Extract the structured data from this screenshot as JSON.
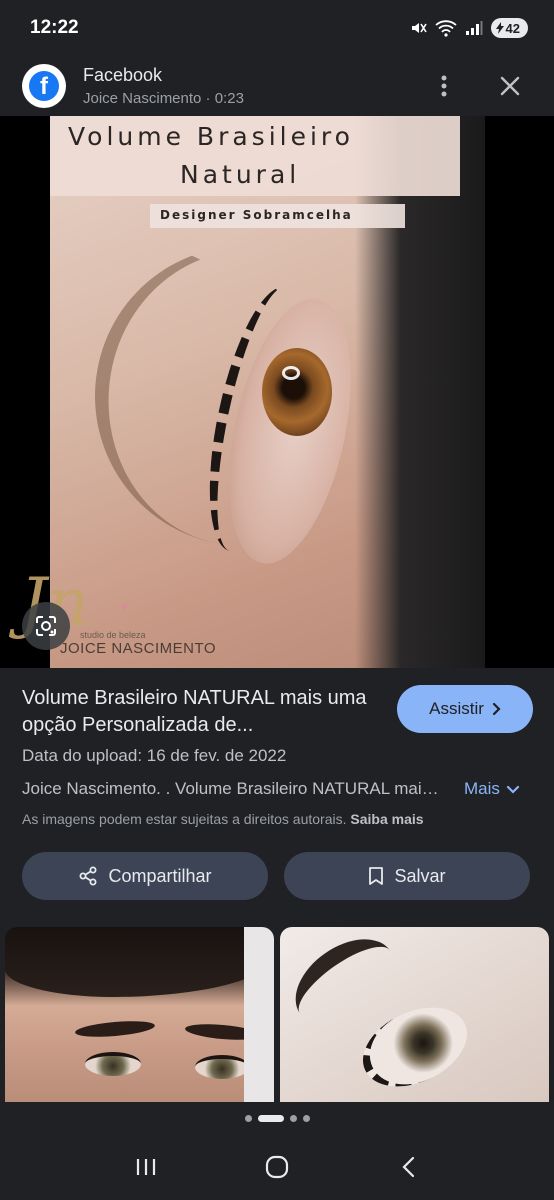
{
  "status_bar": {
    "time": "12:22",
    "battery": "42",
    "network": "5"
  },
  "source": {
    "name": "Facebook",
    "subtitle": "Joice Nascimento · 0:23",
    "logo_letter": "f",
    "brand_color": "#1877f2"
  },
  "image": {
    "title_line1": "Volume Brasileiro",
    "title_line2": "Natural",
    "subtitle": "Designer Sobramcelha",
    "watermark_script": "Jn",
    "watermark_studio": "studio de beleza",
    "watermark_name": "JOICE NASCIMENTO"
  },
  "result": {
    "title": "Volume Brasileiro NATURAL mais uma opção Personalizada de...",
    "upload_date": "Data do upload: 16 de fev. de 2022",
    "description": "Joice Nascimento. . Volume Brasileiro NATURAL mais uma opção Personalizada de",
    "more_label": "Mais",
    "copyright_text": "As imagens podem estar sujeitas a direitos autorais.",
    "learn_more_label": "Saiba mais",
    "watch_label": "Assistir",
    "share_label": "Compartilhar",
    "save_label": "Salvar",
    "accent_color": "#8ab4f8"
  },
  "icons": {
    "lens": "google-lens-icon",
    "more": "more-vert-icon",
    "close": "close-icon",
    "share": "share-icon",
    "save": "bookmark-icon",
    "chevron_right": "chevron-right-icon",
    "chevron_down": "chevron-down-icon"
  },
  "pager": {
    "count": 5,
    "active_index": 1
  }
}
